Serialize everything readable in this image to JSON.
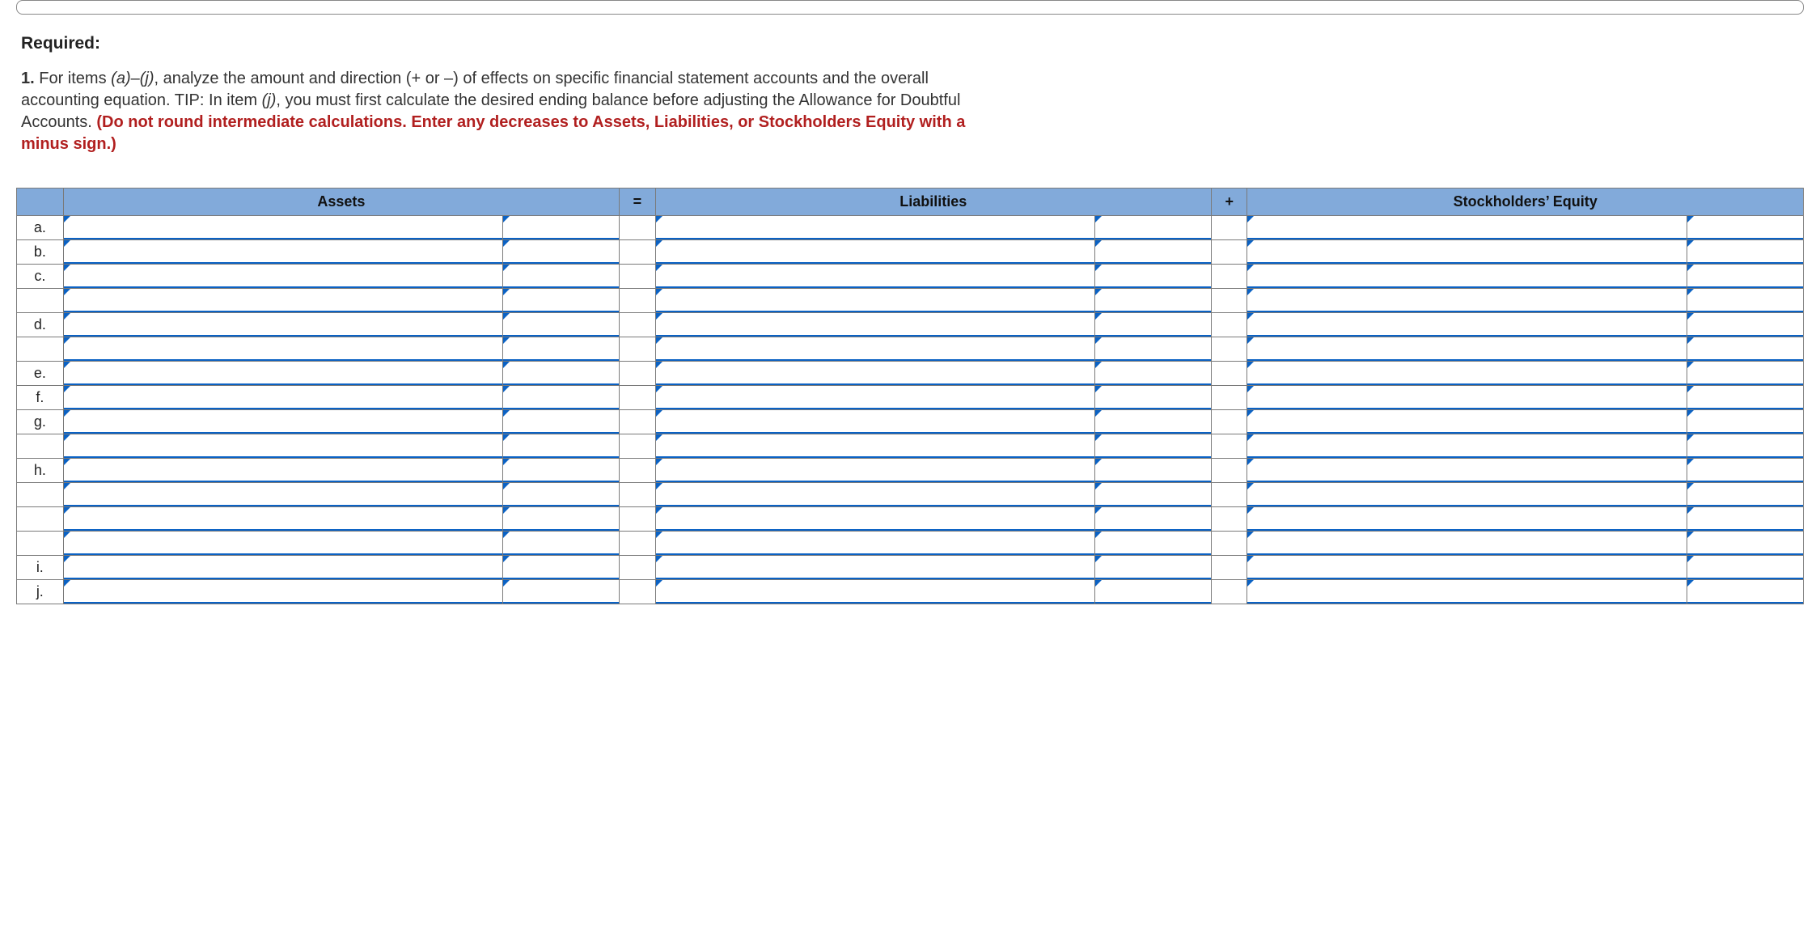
{
  "required_label": "Required:",
  "instruction": {
    "number": "1.",
    "prefix": "For items ",
    "range_a": "(a)",
    "dash": "–",
    "range_j": "(j)",
    "body1": ", analyze the amount and direction (+ or –) of effects on specific financial statement accounts and the overall accounting equation. TIP: In item ",
    "item_j": "(j)",
    "body2": ", you must first calculate the desired ending balance before adjusting the Allowance for Doubtful Accounts. ",
    "warn": "(Do not round intermediate calculations. Enter any decreases to Assets, Liabilities, or Stockholders Equity with a minus sign.)"
  },
  "headers": {
    "assets": "Assets",
    "eq": "=",
    "liabilities": "Liabilities",
    "plus": "+",
    "equity": "Stockholders’ Equity"
  },
  "rows": [
    {
      "label": "a."
    },
    {
      "label": "b."
    },
    {
      "label": "c."
    },
    {
      "label": ""
    },
    {
      "label": "d."
    },
    {
      "label": ""
    },
    {
      "label": "e."
    },
    {
      "label": "f."
    },
    {
      "label": "g."
    },
    {
      "label": ""
    },
    {
      "label": "h."
    },
    {
      "label": ""
    },
    {
      "label": ""
    },
    {
      "label": ""
    },
    {
      "label": "i."
    },
    {
      "label": "j."
    }
  ]
}
